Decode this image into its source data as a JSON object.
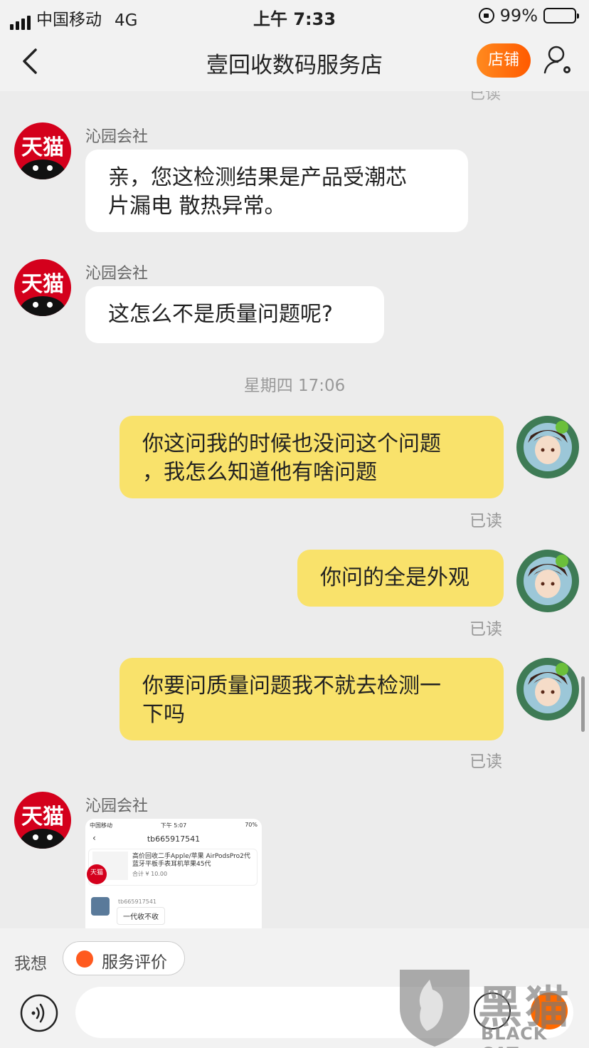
{
  "status_bar": {
    "carrier": "中国移动",
    "network": "4G",
    "time": "上午 7:33",
    "battery": "99%",
    "battery_level": 0.99
  },
  "nav": {
    "title": "壹回收数码服务店",
    "store_button": "店铺"
  },
  "chat": {
    "ghost_read": "已读",
    "messages": [
      {
        "sender": "沁园会社",
        "avatar_text": "天猫",
        "text": "亲，您这检测结果是产品受潮芯\n片漏电 散热异常。"
      },
      {
        "sender": "沁园会社",
        "avatar_text": "天猫",
        "text": "这怎么不是质量问题呢?"
      },
      {
        "timestamp": "星期四 17:06"
      },
      {
        "text": "你这问我的时候也没问这个问题\n，我怎么知道他有啥问题",
        "status": "已读"
      },
      {
        "text": "你问的全是外观",
        "status": "已读"
      },
      {
        "text": "你要问质量问题我不就去检测一\n下吗",
        "status": "已读"
      },
      {
        "sender": "沁园会社",
        "avatar_text": "天猫"
      }
    ],
    "image_message": {
      "carrier": "中国移动",
      "time": "下午 5:07",
      "battery": "70%",
      "title": "tb665917541",
      "product": "高价回收二手Apple/苹果 AirPodsPro2代蓝牙平板手表耳机苹果45代",
      "total": "合计 ¥ 10.00",
      "avatar_text": "天猫",
      "user": "tb665917541",
      "reply": "一代收不收"
    }
  },
  "bottom": {
    "quick_label": "我想",
    "service_chip": "服务评价",
    "input_placeholder": ""
  },
  "watermark": {
    "chars": "黑猫",
    "logo_text": "BLACK CAT"
  }
}
